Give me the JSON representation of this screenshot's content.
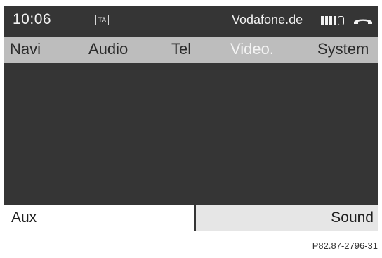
{
  "status_bar": {
    "time": "10:06",
    "ta_icon_label": "TA",
    "carrier": "Vodafone.de",
    "signal_bars_filled": 4,
    "signal_bars_total": 5
  },
  "menu": {
    "items": [
      {
        "label": "Navi"
      },
      {
        "label": "Audio"
      },
      {
        "label": "Tel"
      },
      {
        "label": "Video."
      },
      {
        "label": "System"
      }
    ],
    "active": "Video."
  },
  "soft_buttons": {
    "left_label": "Aux",
    "right_label": "Sound"
  },
  "figure_code": "P82.87-2796-31",
  "colors": {
    "screen_bg": "#353535",
    "menu_bg": "#bdbdbd",
    "menu_active_text": "#f4f4f4"
  }
}
